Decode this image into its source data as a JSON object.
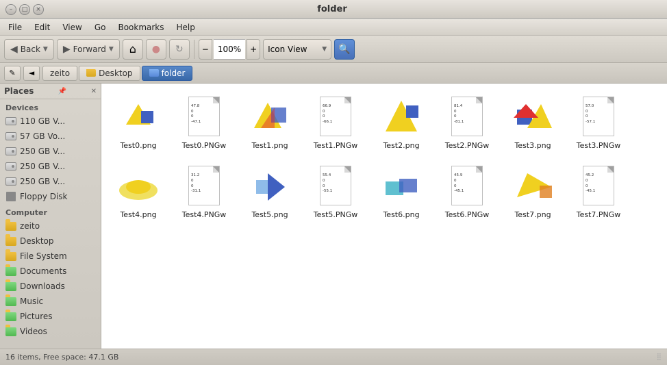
{
  "titlebar": {
    "title": "folder",
    "btn_min": "–",
    "btn_max": "□",
    "btn_close": "×"
  },
  "menubar": {
    "items": [
      "File",
      "Edit",
      "View",
      "Go",
      "Bookmarks",
      "Help"
    ]
  },
  "toolbar": {
    "back_label": "Back",
    "forward_label": "Forward",
    "zoom_value": "100%",
    "view_label": "Icon View",
    "search_icon": "🔍"
  },
  "locationbar": {
    "toggle_icon": "✎",
    "close_icon": "◄",
    "breadcrumbs": [
      "zeito",
      "Desktop",
      "folder"
    ]
  },
  "sidebar": {
    "title": "Places",
    "devices_header": "Devices",
    "devices": [
      {
        "label": "110 GB V...",
        "type": "drive"
      },
      {
        "label": "57 GB Vo...",
        "type": "drive"
      },
      {
        "label": "250 GB V...",
        "type": "drive"
      },
      {
        "label": "250 GB V...",
        "type": "drive"
      },
      {
        "label": "250 GB V...",
        "type": "drive"
      },
      {
        "label": "Floppy Disk",
        "type": "floppy"
      }
    ],
    "computer_header": "Computer",
    "places": [
      {
        "label": "zeito",
        "type": "folder"
      },
      {
        "label": "Desktop",
        "type": "folder"
      },
      {
        "label": "File System",
        "type": "folder"
      },
      {
        "label": "Documents",
        "type": "folder"
      },
      {
        "label": "Downloads",
        "type": "folder"
      },
      {
        "label": "Music",
        "type": "folder"
      },
      {
        "label": "Pictures",
        "type": "folder"
      },
      {
        "label": "Videos",
        "type": "folder"
      }
    ]
  },
  "files": [
    {
      "name": "Test0.png",
      "type": "png",
      "colors": [
        "#f0d020",
        "#4060c0"
      ]
    },
    {
      "name": "Test0.PNGw",
      "type": "pngw",
      "text": "47.8\n0\n0\n-47.1"
    },
    {
      "name": "Test1.png",
      "type": "png",
      "colors": [
        "#f0d020",
        "#4060c0",
        "#e03030"
      ]
    },
    {
      "name": "Test1.PNGw",
      "type": "pngw",
      "text": "66.9\n0\n0\n-66.1"
    },
    {
      "name": "Test2.png",
      "type": "png",
      "colors": [
        "#f0d020",
        "#4060c0",
        "#e03030"
      ]
    },
    {
      "name": "Test2.PNGw",
      "type": "pngw",
      "text": "81.4\n0\n0\n-81.1"
    },
    {
      "name": "Test3.png",
      "type": "png",
      "colors": [
        "#4060c0",
        "#f0d020",
        "#e03030"
      ]
    },
    {
      "name": "Test3.PNGw",
      "type": "pngw",
      "text": "57.0\n0\n0\n-57.1"
    },
    {
      "name": "Test4.png",
      "type": "png",
      "colors": [
        "#f0e060",
        "#f0d020"
      ]
    },
    {
      "name": "Test4.PNGw",
      "type": "pngw",
      "text": "31.2\n0\n0\n-31.1"
    },
    {
      "name": "Test5.png",
      "type": "png",
      "colors": [
        "#60a0e0",
        "#4060c0"
      ]
    },
    {
      "name": "Test5.PNGw",
      "type": "pngw",
      "text": "55.4\n0\n0\n-55.1"
    },
    {
      "name": "Test6.png",
      "type": "png",
      "colors": [
        "#60c0d0",
        "#4060c0",
        "#e03030"
      ]
    },
    {
      "name": "Test6.PNGw",
      "type": "pngw",
      "text": "45.9\n0\n0\n-45.1"
    },
    {
      "name": "Test7.png",
      "type": "png",
      "colors": [
        "#f0d020",
        "#e08020"
      ]
    },
    {
      "name": "Test7.PNGw",
      "type": "pngw",
      "text": "45.2\n0\n0\n-45.1"
    }
  ],
  "statusbar": {
    "info": "16 items, Free space: 47.1 GB"
  }
}
